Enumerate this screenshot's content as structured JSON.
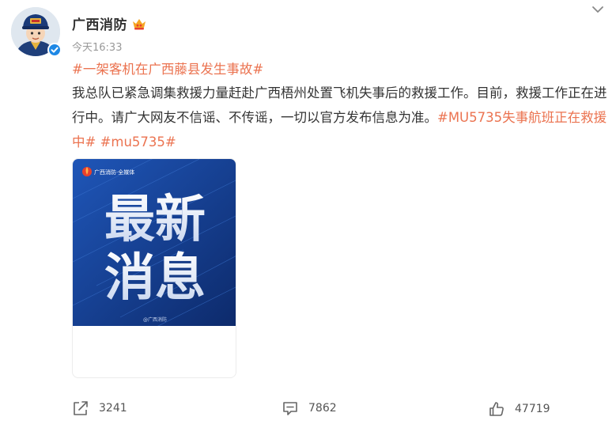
{
  "author": {
    "name": "广西消防"
  },
  "post": {
    "time": "今天16:33",
    "topic": "#一架客机在广西藤县发生事故#",
    "body_text": "我总队已紧急调集救援力量赶赴广西梧州处置飞机失事后的救援工作。目前，救援工作正在进行中。请广大网友不信谣、不传谣，一切以官方发布信息为准。",
    "tags": [
      "#MU5735失事航班正在救援中#",
      "#mu5735#"
    ]
  },
  "image": {
    "brand": "广西消防·全媒体",
    "headline_1": "最新",
    "headline_2": "消息",
    "watermark": "@广西消防",
    "colors": {
      "bg_dark": "#0d2a6b",
      "bg_light": "#1f56b8",
      "accent": "#e8402c"
    }
  },
  "actions": {
    "repost_count": "3241",
    "comment_count": "7862",
    "like_count": "47719"
  },
  "colors": {
    "link": "#eb7350",
    "verified": "#1e88e5",
    "muted": "#999999"
  }
}
